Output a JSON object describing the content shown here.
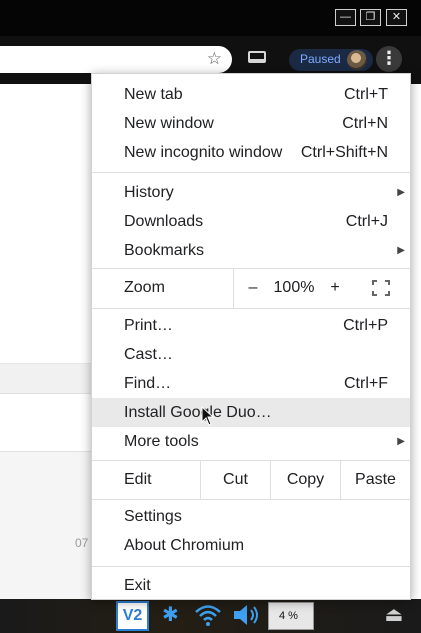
{
  "window": {
    "buttons": [
      "—",
      "❐",
      "✕"
    ]
  },
  "toolbar": {
    "paused_label": "Paused"
  },
  "page": {
    "time_fragment": "07"
  },
  "menu": {
    "group1": [
      {
        "label": "New tab",
        "shortcut": "Ctrl+T"
      },
      {
        "label": "New window",
        "shortcut": "Ctrl+N"
      },
      {
        "label": "New incognito window",
        "shortcut": "Ctrl+Shift+N"
      }
    ],
    "group2": [
      {
        "label": "History",
        "shortcut": "",
        "submenu": true
      },
      {
        "label": "Downloads",
        "shortcut": "Ctrl+J"
      },
      {
        "label": "Bookmarks",
        "shortcut": "",
        "submenu": true
      }
    ],
    "zoom": {
      "label": "Zoom",
      "minus": "–",
      "value": "100%",
      "plus": "+"
    },
    "group3": [
      {
        "label": "Print…",
        "shortcut": "Ctrl+P"
      },
      {
        "label": "Cast…",
        "shortcut": ""
      },
      {
        "label": "Find…",
        "shortcut": "Ctrl+F"
      },
      {
        "label": "Install Google Duo…",
        "shortcut": "",
        "highlighted": true
      },
      {
        "label": "More tools",
        "shortcut": "",
        "submenu": true
      }
    ],
    "edit": {
      "label": "Edit",
      "cut": "Cut",
      "copy": "Copy",
      "paste": "Paste"
    },
    "group4": [
      {
        "label": "Settings"
      },
      {
        "label": "About Chromium"
      }
    ],
    "exit": "Exit"
  },
  "taskbar": {
    "vnc_label": "V2",
    "battery_text": "4 %"
  },
  "colors": {
    "menu_bg": "#ffffff",
    "hover_bg": "#e9e9e9",
    "paused_text": "#7eaaff",
    "tray_blue": "#3ea0f0"
  }
}
